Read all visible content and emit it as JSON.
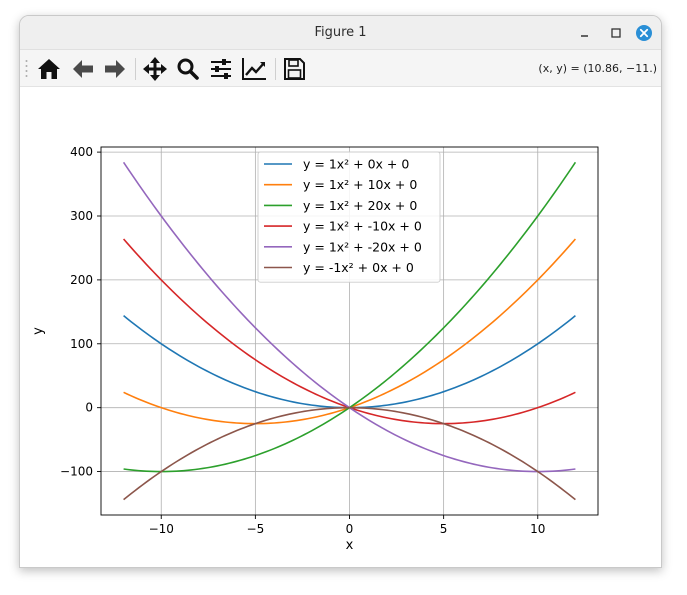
{
  "window": {
    "title": "Figure 1"
  },
  "toolbar": {
    "buttons": [
      {
        "icon": "home-icon",
        "label": "Home"
      },
      {
        "icon": "back-arrow-icon",
        "label": "Back"
      },
      {
        "icon": "forward-arrow-icon",
        "label": "Forward"
      },
      {
        "icon": "move-icon",
        "label": "Pan"
      },
      {
        "icon": "zoom-icon",
        "label": "Zoom"
      },
      {
        "icon": "sliders-icon",
        "label": "Subplots"
      },
      {
        "icon": "trend-icon",
        "label": "Customize"
      },
      {
        "icon": "save-icon",
        "label": "Save"
      }
    ],
    "coords": "(x, y) = (10.86, −11.)"
  },
  "colors": {
    "c1": "#1f77b4",
    "c2": "#ff7f0e",
    "c3": "#2ca02c",
    "c4": "#d62728",
    "c5": "#9467bd",
    "c6": "#8c564b",
    "close": "#2a8fd6"
  },
  "chart_data": {
    "type": "line",
    "xlabel": "x",
    "ylabel": "y",
    "xlim": [
      -13.2,
      13.2
    ],
    "ylim": [
      -168,
      408
    ],
    "x_ticks": [
      -10,
      -5,
      0,
      5,
      10
    ],
    "y_ticks": [
      -100,
      0,
      100,
      200,
      300,
      400
    ],
    "x_tick_labels": [
      "−10",
      "−5",
      "0",
      "5",
      "10"
    ],
    "y_tick_labels": [
      "−100",
      "0",
      "100",
      "200",
      "300",
      "400"
    ],
    "x_range": [
      -12,
      12
    ],
    "grid": true,
    "legend_position": "upper center",
    "series": [
      {
        "name": "y = 1x² + 0x + 0",
        "a": 1,
        "b": 0,
        "c": 0,
        "color": "#1f77b4"
      },
      {
        "name": "y = 1x² + 10x + 0",
        "a": 1,
        "b": 10,
        "c": 0,
        "color": "#ff7f0e"
      },
      {
        "name": "y = 1x² + 20x + 0",
        "a": 1,
        "b": 20,
        "c": 0,
        "color": "#2ca02c"
      },
      {
        "name": "y = 1x² + -10x + 0",
        "a": 1,
        "b": -10,
        "c": 0,
        "color": "#d62728"
      },
      {
        "name": "y = 1x² + -20x + 0",
        "a": 1,
        "b": -20,
        "c": 0,
        "color": "#9467bd"
      },
      {
        "name": "y = -1x² + 0x + 0",
        "a": -1,
        "b": 0,
        "c": 0,
        "color": "#8c564b"
      }
    ]
  }
}
